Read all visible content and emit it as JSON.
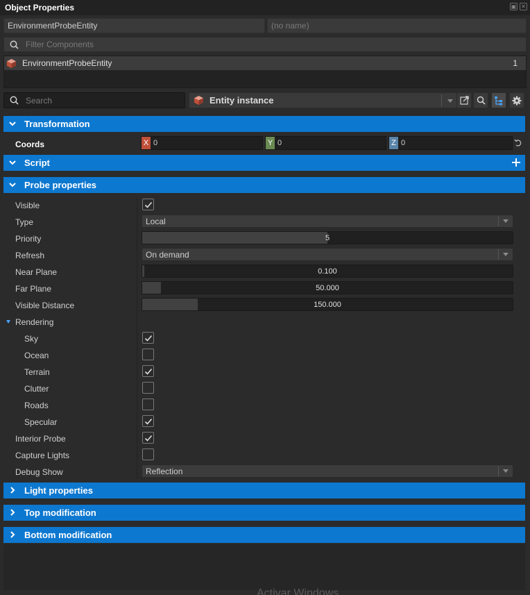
{
  "window": {
    "title": "Object Properties"
  },
  "header": {
    "entity_name": "EnvironmentProbeEntity",
    "name_placeholder": "(no name)",
    "filter_placeholder": "Filter Components"
  },
  "entity_list": {
    "items": [
      {
        "label": "EnvironmentProbeEntity",
        "count": "1"
      }
    ]
  },
  "toolbar": {
    "search_placeholder": "Search",
    "entity_dropdown": "Entity instance"
  },
  "sections": {
    "transformation": "Transformation",
    "script": "Script",
    "probe": "Probe properties",
    "light": "Light properties",
    "top_mod": "Top modification",
    "bottom_mod": "Bottom modification"
  },
  "coords": {
    "label": "Coords",
    "x_axis": "X",
    "x": "0",
    "y_axis": "Y",
    "y": "0",
    "z_axis": "Z",
    "z": "0"
  },
  "probe": {
    "visible": {
      "label": "Visible",
      "checked": true
    },
    "type": {
      "label": "Type",
      "value": "Local"
    },
    "priority": {
      "label": "Priority",
      "value": "5",
      "fill_percent": 50
    },
    "refresh": {
      "label": "Refresh",
      "value": "On demand"
    },
    "near_plane": {
      "label": "Near Plane",
      "value": "0.100",
      "fill_percent": 0.5
    },
    "far_plane": {
      "label": "Far Plane",
      "value": "50.000",
      "fill_percent": 5
    },
    "visible_distance": {
      "label": "Visible Distance",
      "value": "150.000",
      "fill_percent": 15
    },
    "rendering": {
      "label": "Rendering",
      "sky": {
        "label": "Sky",
        "checked": true
      },
      "ocean": {
        "label": "Ocean",
        "checked": false
      },
      "terrain": {
        "label": "Terrain",
        "checked": true
      },
      "clutter": {
        "label": "Clutter",
        "checked": false
      },
      "roads": {
        "label": "Roads",
        "checked": false
      },
      "specular": {
        "label": "Specular",
        "checked": true
      }
    },
    "interior_probe": {
      "label": "Interior Probe",
      "checked": true
    },
    "capture_lights": {
      "label": "Capture Lights",
      "checked": false
    },
    "debug_show": {
      "label": "Debug Show",
      "value": "Reflection"
    }
  },
  "colors": {
    "section_header": "#0d78d0",
    "x_axis": "#c0503a",
    "y_axis": "#6a8a52",
    "z_axis": "#5a84a8"
  },
  "footer": {
    "watermark": "Activar Windows"
  }
}
